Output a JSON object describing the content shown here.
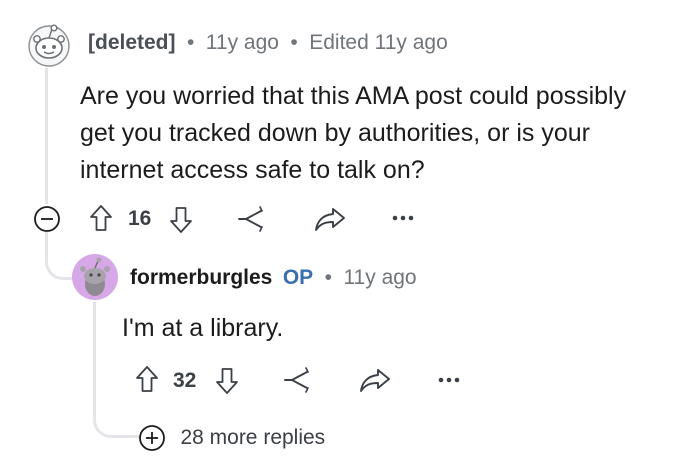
{
  "comment": {
    "author": "[deleted]",
    "age": "11y ago",
    "edited": "Edited 11y ago",
    "separator": "•",
    "text_lines": [
      "Are you worried that this AMA post could possibly",
      "get you tracked down by authorities, or is your",
      "internet access safe to talk on?"
    ],
    "score": "16"
  },
  "reply": {
    "author": "formerburgles",
    "op_badge": "OP",
    "separator": "•",
    "age": "11y ago",
    "text": "I'm at a library.",
    "score": "32"
  },
  "more_replies": {
    "label": "28 more replies"
  },
  "icons": {
    "collapse": "collapse-minus-icon",
    "upvote": "upvote-arrow-icon",
    "downvote": "downvote-arrow-icon",
    "award": "award-icon",
    "share": "share-arrow-icon",
    "overflow": "overflow-dots-icon",
    "expand": "expand-plus-icon"
  },
  "colors": {
    "op_badge": "#3a6fb0",
    "avatar_reply": "#d7a8e8",
    "text": "#1c1c1c",
    "meta": "#6f757a"
  }
}
